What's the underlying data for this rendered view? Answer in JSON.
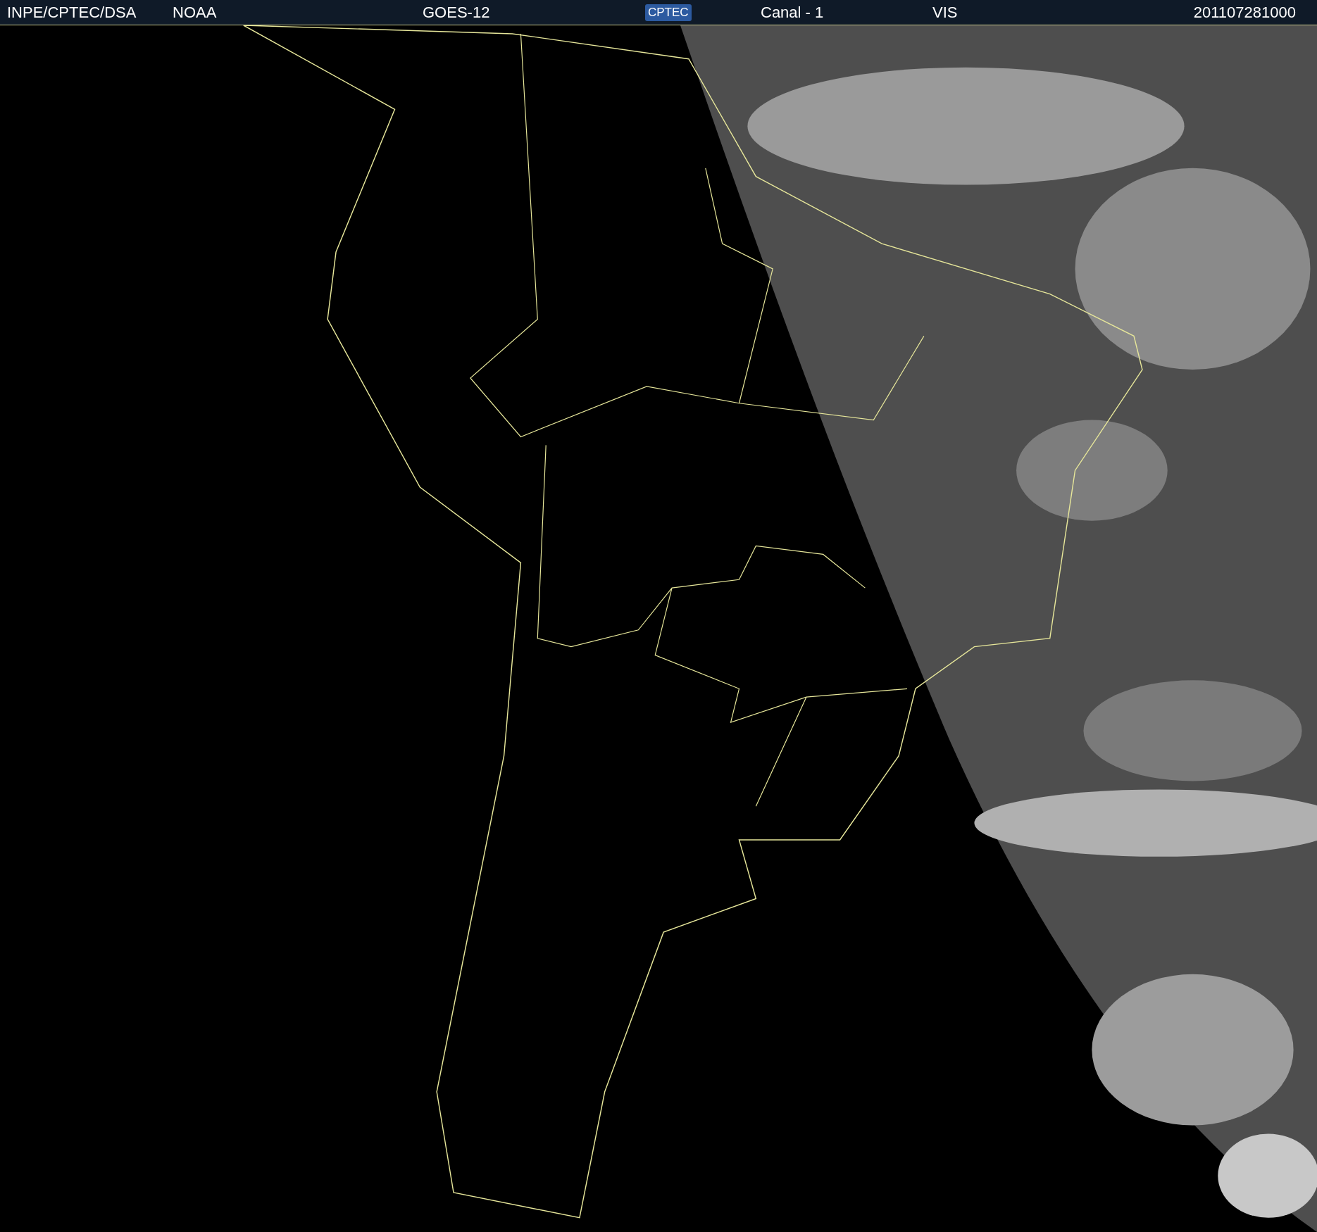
{
  "header": {
    "source": "INPE/CPTEC/DSA",
    "agency": "NOAA",
    "satellite": "GOES-12",
    "logo": "CPTEC",
    "channel": "Canal - 1",
    "band": "VIS",
    "timestamp": "201107281000"
  }
}
